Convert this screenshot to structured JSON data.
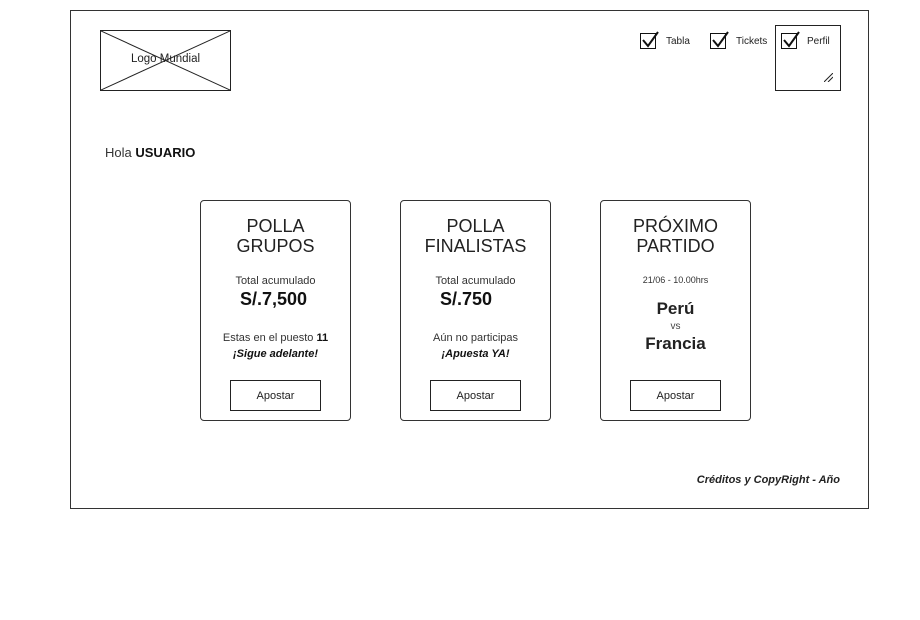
{
  "header": {
    "logo_text": "Logo Mundial",
    "nav": {
      "tabla": "Tabla",
      "tickets": "Tickets",
      "perfil": "Perfil"
    }
  },
  "greeting": {
    "prefix": "Hola",
    "user": "USUARIO"
  },
  "cards": {
    "grupos": {
      "title_line1": "POLLA",
      "title_line2": "GRUPOS",
      "total_label": "Total acumulado",
      "total_value": "S/.7,500",
      "status_prefix": "Estas en el puesto",
      "position": "11",
      "cta": "¡Sigue adelante!",
      "button": "Apostar"
    },
    "finalistas": {
      "title_line1": "POLLA",
      "title_line2": "FINALISTAS",
      "total_label": "Total acumulado",
      "total_value": "S/.750",
      "status": "Aún no participas",
      "cta": "¡Apuesta YA!",
      "button": "Apostar"
    },
    "proximo": {
      "title_line1": "PRÓXIMO",
      "title_line2": "PARTIDO",
      "date": "21/06 - 10.00hrs",
      "team1": "Perú",
      "vs": "vs",
      "team2": "Francia",
      "button": "Apostar"
    }
  },
  "footer": {
    "credits": "Créditos y CopyRight - Año"
  }
}
